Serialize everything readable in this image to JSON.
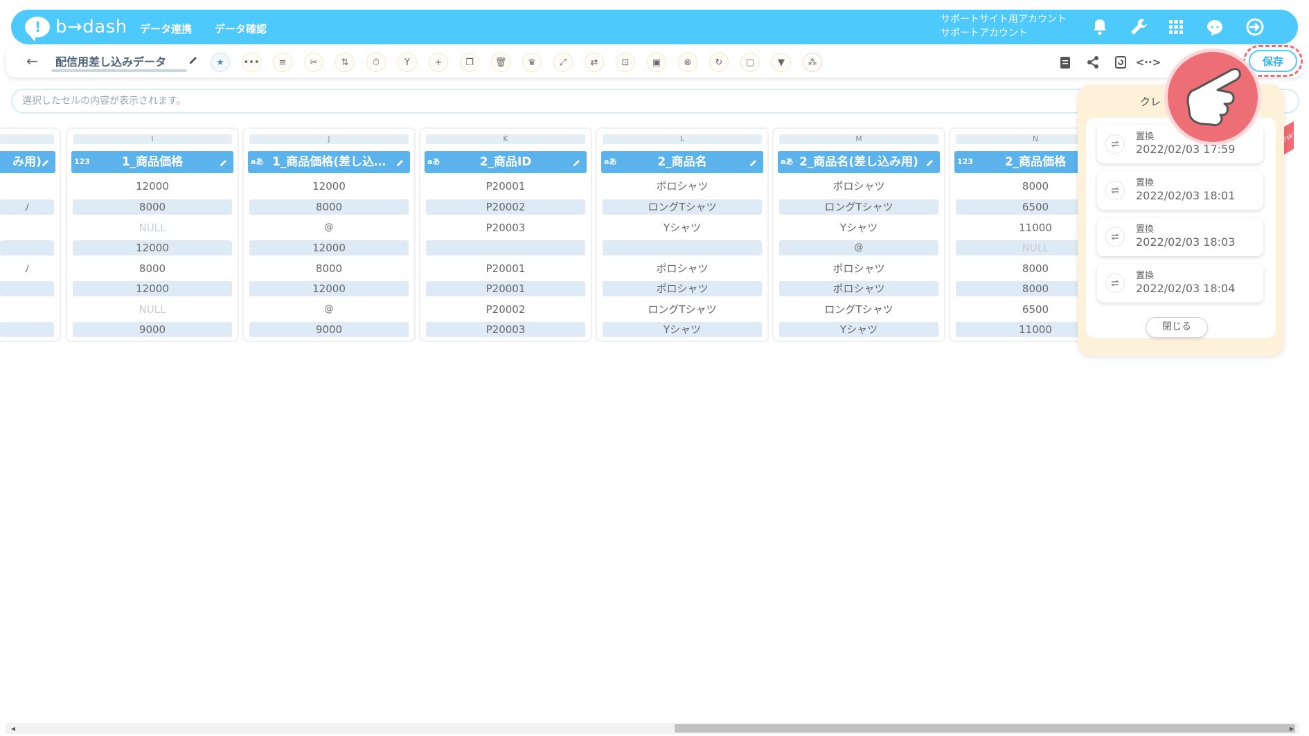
{
  "header": {
    "logo_text": "b→dash",
    "nav": [
      "データ連携",
      "データ確認"
    ],
    "account_line1": "サポートサイト用アカウント",
    "account_line2": "サポートアカウント"
  },
  "toolbar": {
    "title": "配信用差し込みデータ",
    "save_label": "保存"
  },
  "cellbar": {
    "placeholder": "選択したセルの内容が表示されます。"
  },
  "grid": {
    "columns": [
      {
        "letter": "",
        "type": "",
        "header": "み用)",
        "cells": [
          "",
          "ﾉ",
          "",
          "",
          "ﾉ",
          "",
          "",
          ""
        ]
      },
      {
        "letter": "I",
        "type": "123",
        "header": "1_商品価格",
        "cells": [
          "12000",
          "8000",
          "NULL",
          "12000",
          "8000",
          "12000",
          "NULL",
          "9000"
        ]
      },
      {
        "letter": "J",
        "type": "aあ",
        "header": "1_商品価格(差し込…",
        "cells": [
          "12000",
          "8000",
          "@",
          "12000",
          "8000",
          "12000",
          "@",
          "9000"
        ]
      },
      {
        "letter": "K",
        "type": "aあ",
        "header": "2_商品ID",
        "cells": [
          "P20001",
          "P20002",
          "P20003",
          "",
          "P20001",
          "P20001",
          "P20002",
          "P20003"
        ]
      },
      {
        "letter": "L",
        "type": "aあ",
        "header": "2_商品名",
        "cells": [
          "ポロシャツ",
          "ロングTシャツ",
          "Yシャツ",
          "",
          "ポロシャツ",
          "ポロシャツ",
          "ロングTシャツ",
          "Yシャツ"
        ]
      },
      {
        "letter": "M",
        "type": "aあ",
        "header": "2_商品名(差し込み用)",
        "cells": [
          "ポロシャツ",
          "ロングTシャツ",
          "Yシャツ",
          "@",
          "ポロシャツ",
          "ポロシャツ",
          "ロングTシャツ",
          "Yシャツ"
        ]
      },
      {
        "letter": "N",
        "type": "123",
        "header": "2_商品価格",
        "cells": [
          "8000",
          "6500",
          "11000",
          "NULL",
          "8000",
          "8000",
          "6500",
          "11000"
        ]
      }
    ]
  },
  "history": {
    "title": "クレ",
    "items": [
      {
        "label": "置換",
        "time": "2022/02/03 17:59"
      },
      {
        "label": "置換",
        "time": "2022/02/03 18:01"
      },
      {
        "label": "置換",
        "time": "2022/02/03 18:03"
      },
      {
        "label": "置換",
        "time": "2022/02/03 18:04"
      }
    ],
    "close_label": "閉じる",
    "new_tag": "NEW"
  },
  "colors": {
    "brand": "#4dc9fb",
    "header_col": "#5cb2eb",
    "accent_red": "#ee6e76"
  }
}
